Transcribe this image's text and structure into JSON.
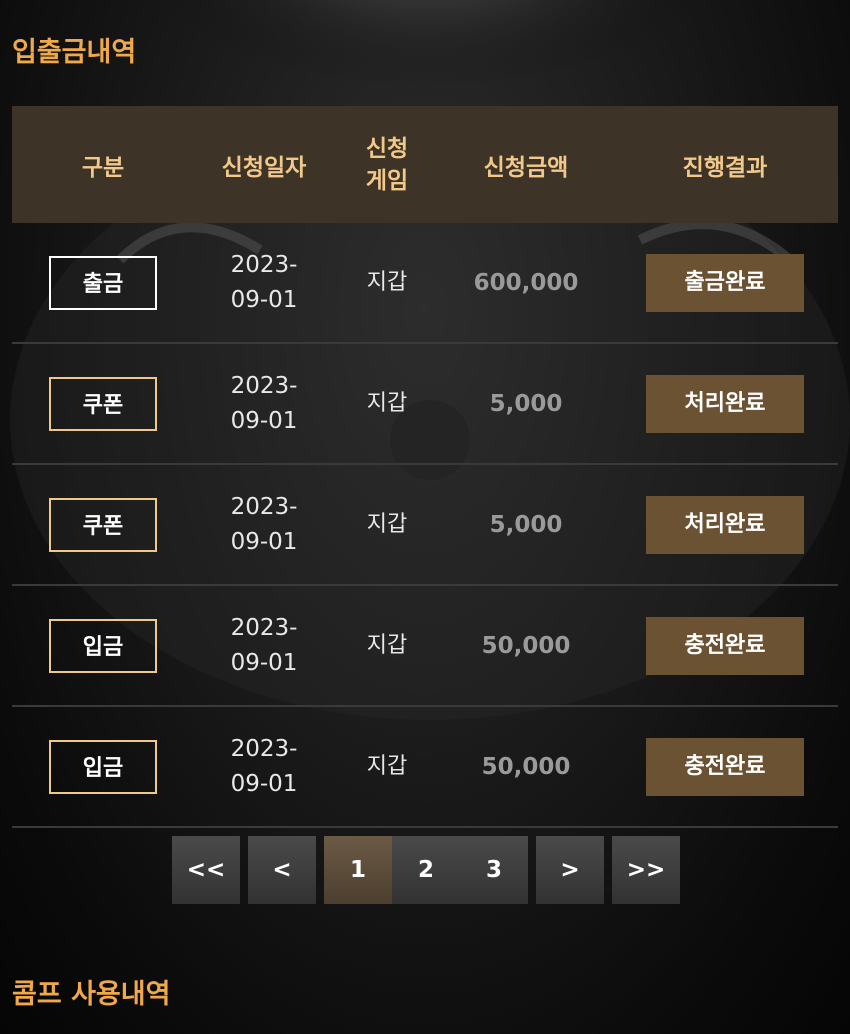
{
  "deposit_section": {
    "title": "입출금내역",
    "columns": [
      "구분",
      "신청일자",
      "신청\n게임",
      "신청금액",
      "진행결과"
    ],
    "rows": [
      {
        "type": "출금",
        "date_line1": "2023-",
        "date_line2": "09-01",
        "game": "지갑",
        "amount": "600,000",
        "result": "출금완료"
      },
      {
        "type": "쿠폰",
        "date_line1": "2023-",
        "date_line2": "09-01",
        "game": "지갑",
        "amount": "5,000",
        "result": "처리완료"
      },
      {
        "type": "쿠폰",
        "date_line1": "2023-",
        "date_line2": "09-01",
        "game": "지갑",
        "amount": "5,000",
        "result": "처리완료"
      },
      {
        "type": "입금",
        "date_line1": "2023-",
        "date_line2": "09-01",
        "game": "지갑",
        "amount": "50,000",
        "result": "충전완료"
      },
      {
        "type": "입금",
        "date_line1": "2023-",
        "date_line2": "09-01",
        "game": "지갑",
        "amount": "50,000",
        "result": "충전완료"
      }
    ]
  },
  "pagination": {
    "first": "<<",
    "prev": "<",
    "pages": [
      "1",
      "2",
      "3"
    ],
    "current": "1",
    "next": ">",
    "last": ">>"
  },
  "comp_section": {
    "title": "콤프 사용내역"
  },
  "colors": {
    "accent_orange": "#f0a94a",
    "header_bg": "#3d3427",
    "header_text": "#f2c98a",
    "result_button": "#6a5233"
  }
}
